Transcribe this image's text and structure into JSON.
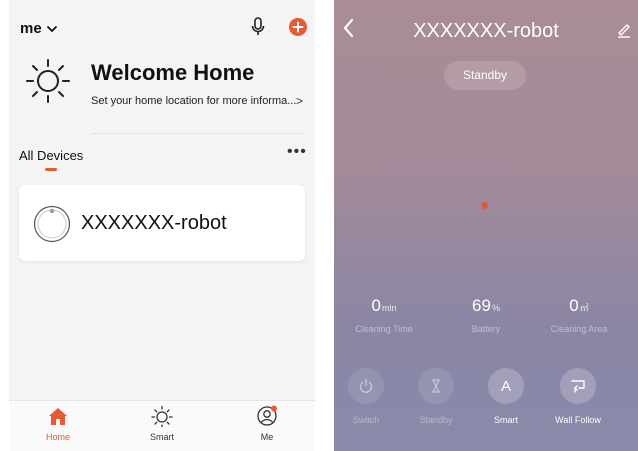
{
  "home": {
    "home_name": "me",
    "welcome_title": "Welcome Home",
    "welcome_subtitle": "Set your home location for more informa...",
    "welcome_arrow": ">",
    "section_title": "All Devices",
    "more_label": "•••",
    "device": {
      "name": "XXXXXXX-robot"
    },
    "tabs": [
      {
        "label": "Home",
        "icon": "home-icon",
        "active": true
      },
      {
        "label": "Smart",
        "icon": "sun-icon",
        "active": false
      },
      {
        "label": "Me",
        "icon": "user-icon",
        "active": false
      }
    ],
    "accent_color": "#e85a32"
  },
  "robot": {
    "title": "XXXXXXX-robot",
    "status": "Standby",
    "stats": [
      {
        "value": "0",
        "unit": "min",
        "caption": "Cleaning Time"
      },
      {
        "value": "69",
        "unit": "%",
        "caption": "Battery"
      },
      {
        "value": "0",
        "unit": "㎡",
        "caption": "Cleaning Area"
      }
    ],
    "modes": [
      {
        "label": "Switch",
        "icon": "power-icon"
      },
      {
        "label": "Standby",
        "icon": "hourglass-icon"
      },
      {
        "label": "Smart",
        "icon": "smart-a-icon",
        "glyph": "A"
      },
      {
        "label": "Wall Follow",
        "icon": "wall-follow-icon"
      }
    ]
  }
}
